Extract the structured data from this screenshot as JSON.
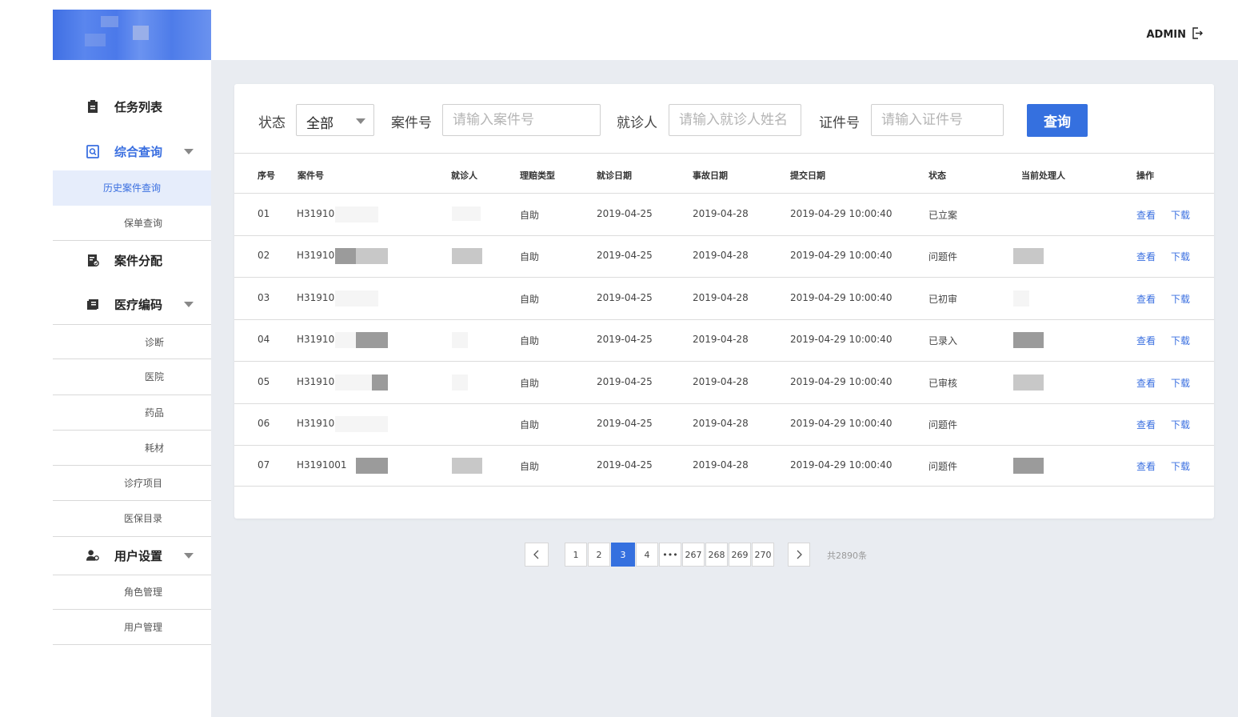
{
  "header": {
    "user": "ADMIN"
  },
  "sidebar": {
    "groups": [
      {
        "label": "任务列表",
        "icon": "clipboard-icon"
      },
      {
        "label": "综合查询",
        "icon": "search-doc-icon"
      },
      {
        "label": "案件分配",
        "icon": "assign-doc-icon"
      },
      {
        "label": "医疗编码",
        "icon": "book-icon"
      },
      {
        "label": "用户设置",
        "icon": "user-gear-icon"
      }
    ],
    "query_items": [
      "历史案件查询",
      "保单查询"
    ],
    "coding_items": [
      "诊断",
      "医院",
      "药品",
      "耗材",
      "诊疗项目",
      "医保目录"
    ],
    "user_items": [
      "角色管理",
      "用户管理"
    ]
  },
  "filters": {
    "status_label": "状态",
    "status_value": "全部",
    "case_label": "案件号",
    "case_placeholder": "请输入案件号",
    "patient_label": "就诊人",
    "patient_placeholder": "请输入就诊人姓名",
    "id_label": "证件号",
    "id_placeholder": "请输入证件号",
    "query_button": "查询"
  },
  "table": {
    "columns": [
      "序号",
      "案件号",
      "就诊人",
      "理赔类型",
      "就诊日期",
      "事故日期",
      "提交日期",
      "状态",
      "当前处理人",
      "操作"
    ],
    "rows": [
      {
        "no": "01",
        "case": "H31910",
        "type": "自助",
        "visit": "2019-04-25",
        "accident": "2019-04-28",
        "submit": "2019-04-29 10:00:40",
        "status": "已立案"
      },
      {
        "no": "02",
        "case": "H31910",
        "type": "自助",
        "visit": "2019-04-25",
        "accident": "2019-04-28",
        "submit": "2019-04-29 10:00:40",
        "status": "问题件"
      },
      {
        "no": "03",
        "case": "H31910",
        "type": "自助",
        "visit": "2019-04-25",
        "accident": "2019-04-28",
        "submit": "2019-04-29 10:00:40",
        "status": "已初审"
      },
      {
        "no": "04",
        "case": "H31910",
        "type": "自助",
        "visit": "2019-04-25",
        "accident": "2019-04-28",
        "submit": "2019-04-29 10:00:40",
        "status": "已录入"
      },
      {
        "no": "05",
        "case": "H31910",
        "type": "自助",
        "visit": "2019-04-25",
        "accident": "2019-04-28",
        "submit": "2019-04-29 10:00:40",
        "status": "已审核"
      },
      {
        "no": "06",
        "case": "H31910",
        "type": "自助",
        "visit": "2019-04-25",
        "accident": "2019-04-28",
        "submit": "2019-04-29 10:00:40",
        "status": "问题件"
      },
      {
        "no": "07",
        "case": "H3191001",
        "type": "自助",
        "visit": "2019-04-25",
        "accident": "2019-04-28",
        "submit": "2019-04-29 10:00:40",
        "status": "问题件"
      }
    ],
    "action_view": "查看",
    "action_download": "下载"
  },
  "pagination": {
    "pages": [
      "1",
      "2",
      "3",
      "4",
      "•••",
      "267",
      "268",
      "269",
      "270"
    ],
    "current": "3",
    "total_text": "共2890条"
  }
}
